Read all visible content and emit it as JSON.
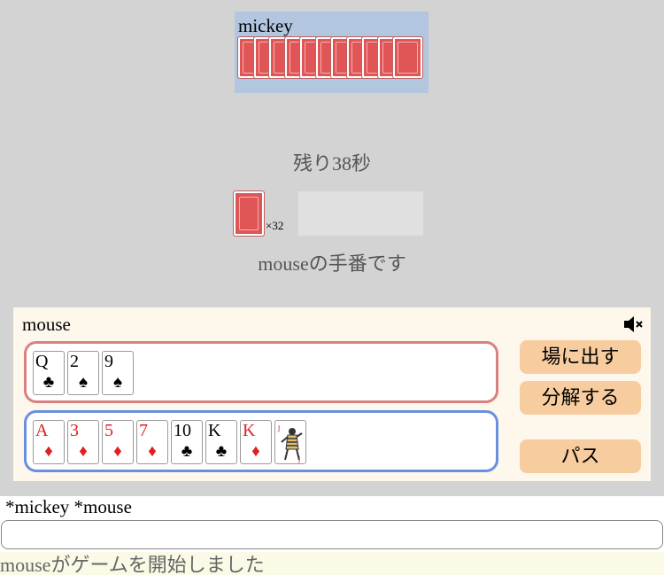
{
  "opponent": {
    "name": "mickey",
    "card_count": 11
  },
  "timer_text": "残り38秒",
  "deck": {
    "count_label": "×32"
  },
  "turn_message": "mouseの手番です",
  "player": {
    "name": "mouse",
    "selected_cards": [
      {
        "rank": "Q",
        "suit": "♣",
        "color": "black"
      },
      {
        "rank": "2",
        "suit": "♠",
        "color": "black"
      },
      {
        "rank": "9",
        "suit": "♠",
        "color": "black"
      }
    ],
    "hand_cards": [
      {
        "rank": "A",
        "suit": "♦",
        "color": "red"
      },
      {
        "rank": "3",
        "suit": "♦",
        "color": "red"
      },
      {
        "rank": "5",
        "suit": "♦",
        "color": "red"
      },
      {
        "rank": "7",
        "suit": "♦",
        "color": "red"
      },
      {
        "rank": "10",
        "suit": "♣",
        "color": "black"
      },
      {
        "rank": "K",
        "suit": "♣",
        "color": "black"
      },
      {
        "rank": "K",
        "suit": "♦",
        "color": "red"
      },
      {
        "rank": "JOKER",
        "suit": "",
        "color": "joker"
      }
    ]
  },
  "buttons": {
    "play": "場に出す",
    "split": "分解する",
    "pass": "パス"
  },
  "mute_icon": "speaker-mute-icon",
  "players_list": "*mickey  *mouse",
  "chat_input": {
    "value": "",
    "placeholder": ""
  },
  "log_message": "mouseがゲームを開始しました",
  "colors": {
    "background": "#d3d3d3",
    "opponent_panel": "#b3c6e0",
    "player_panel": "#fdf7ec",
    "selected_border": "#d98080",
    "hand_border": "#6a8fdc",
    "button": "#f7cd9f",
    "red_suit": "#e02020",
    "card_back": "#e05555"
  }
}
